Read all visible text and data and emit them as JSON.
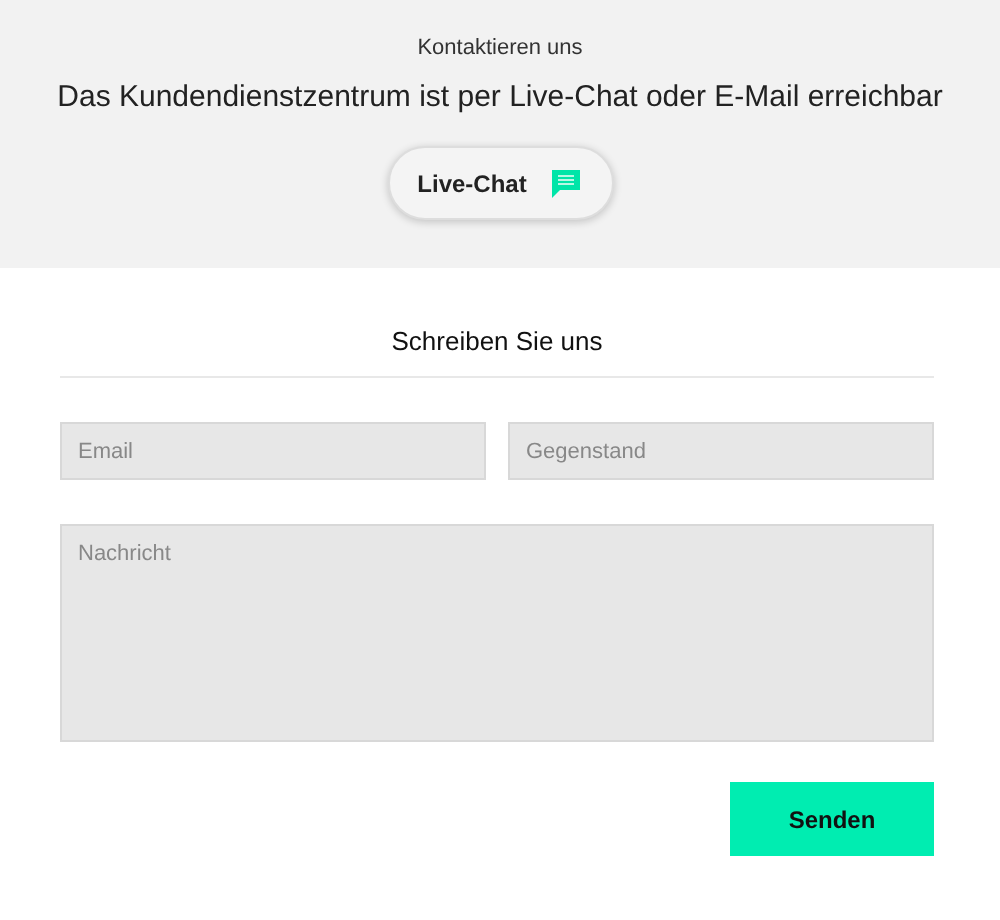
{
  "header": {
    "eyebrow": "Kontaktieren uns",
    "title": "Das Kundendienstzentrum ist per Live-Chat oder E-Mail erreichbar",
    "chat_button": "Live-Chat"
  },
  "form": {
    "title": "Schreiben Sie uns",
    "fields": [
      {
        "placeholder": "Email"
      },
      {
        "placeholder": "Gegenstand"
      }
    ],
    "message": {
      "placeholder": "Nachricht"
    },
    "submit": "Senden"
  }
}
